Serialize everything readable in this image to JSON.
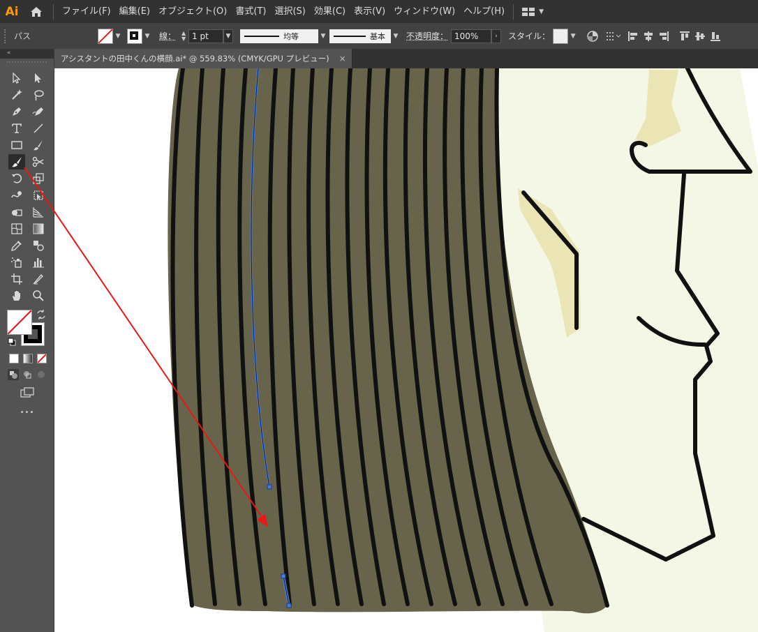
{
  "app": {
    "logo": "Ai"
  },
  "menu": {
    "items": [
      "ファイル(F)",
      "編集(E)",
      "オブジェクト(O)",
      "書式(T)",
      "選択(S)",
      "効果(C)",
      "表示(V)",
      "ウィンドウ(W)",
      "ヘルプ(H)"
    ]
  },
  "control": {
    "selection_type": "パス",
    "stroke_label": "線：",
    "stroke_weight": "1 pt",
    "profile_label": "均等",
    "brush_label": "基本",
    "opacity_label": "不透明度：",
    "opacity_value": "100%",
    "style_label": "スタイル："
  },
  "document": {
    "tab_title": "アシスタントの田中くんの横顔.ai* @ 559.83% (CMYK/GPU プレビュー)",
    "close_glyph": "×"
  },
  "toolbar": {
    "collapse_glyph": "«",
    "more_glyph": "•••",
    "active_tool": "paintbrush-tool"
  },
  "colors": {
    "hair_fill": "#68644b",
    "skin_fill": "#f4f7e6",
    "shadow_fill": "#ebe4b5",
    "outline": "#111111",
    "selection_path": "#4a7bd8",
    "annotation_arrow": "#e81818",
    "ai_brand": "#ff9a00"
  }
}
